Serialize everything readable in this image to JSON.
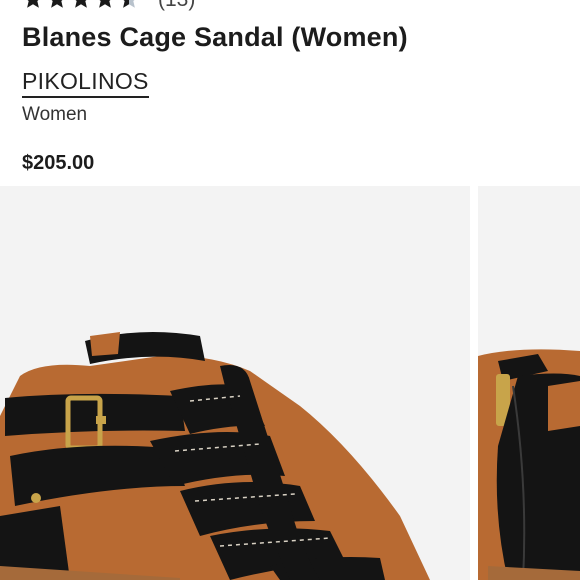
{
  "product": {
    "rating_stars": 4.5,
    "review_count": "(13)",
    "title": "Blanes Cage Sandal (Women)",
    "brand": "PIKOLINOS",
    "category": "Women",
    "price": "$205.00"
  },
  "gallery": {
    "images": [
      {
        "alt_icon": "sandal-front-icon"
      },
      {
        "alt_icon": "sandal-back-icon"
      }
    ]
  },
  "colors": {
    "star": "#1a1a1a",
    "star_empty": "#b8c2cc",
    "leather": "#141414",
    "lining": "#b86a32",
    "buckle": "#c8a44a",
    "background": "#f3f3f3"
  }
}
